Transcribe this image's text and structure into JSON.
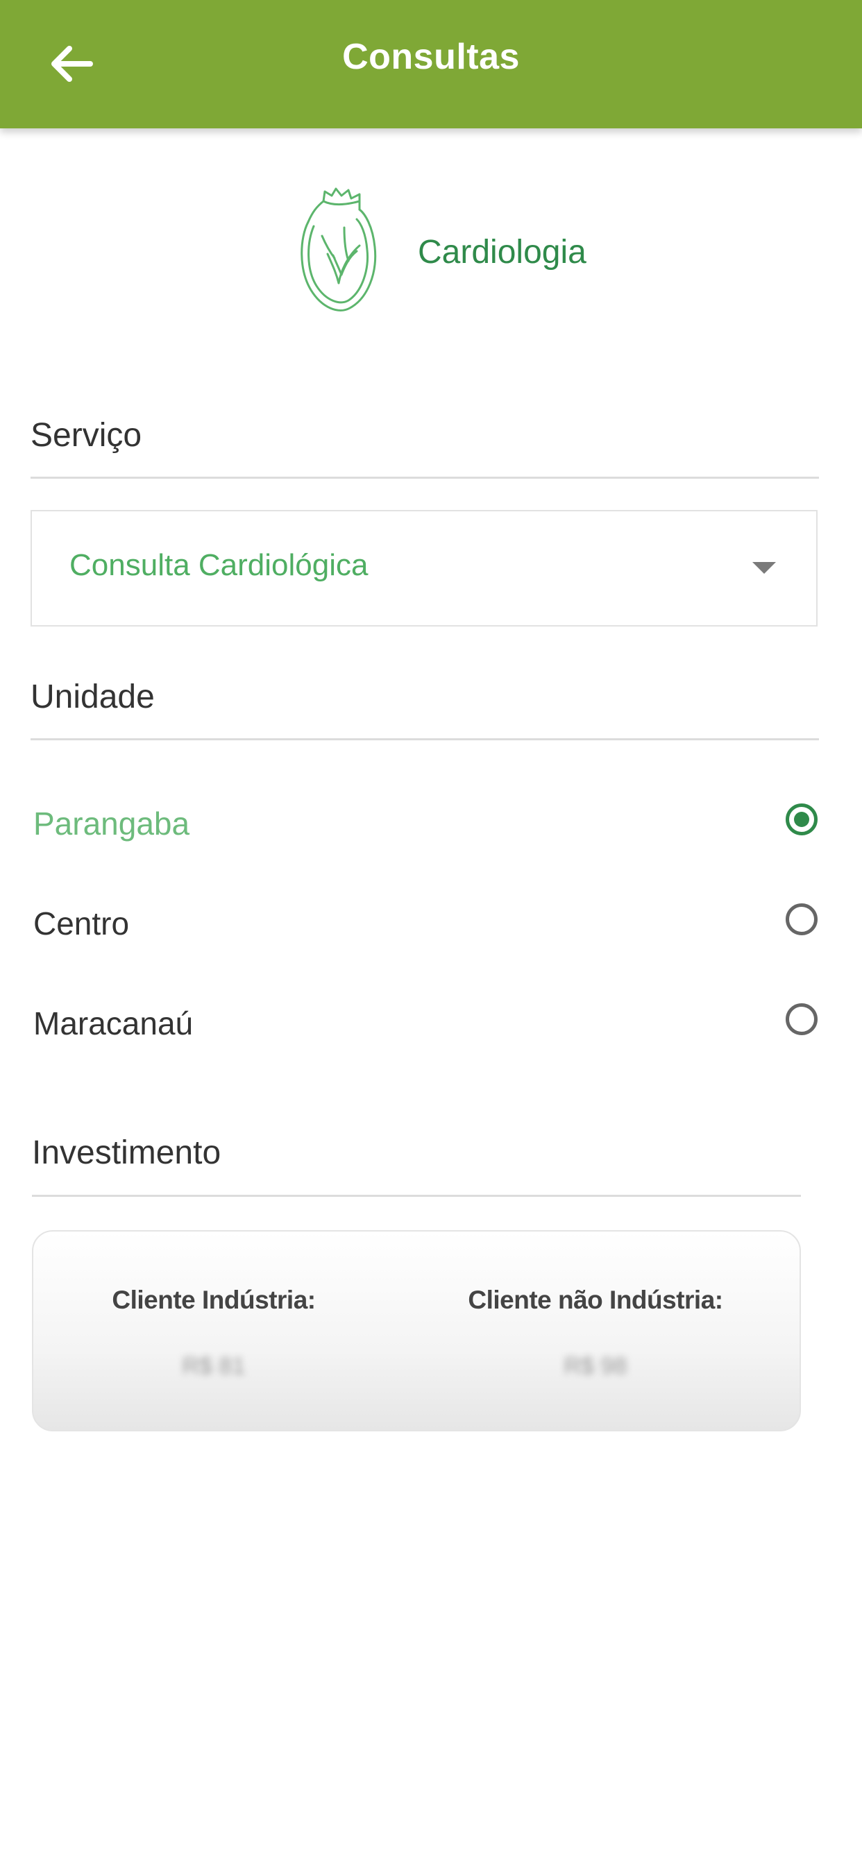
{
  "header": {
    "title": "Consultas",
    "back_icon": "arrow-left-icon",
    "color": "#7fa836"
  },
  "specialty": {
    "icon": "heart-icon",
    "name": "Cardiologia"
  },
  "service": {
    "label": "Serviço",
    "selected": "Consulta Cardiológica"
  },
  "unit": {
    "label": "Unidade",
    "options": [
      {
        "label": "Parangaba",
        "selected": true
      },
      {
        "label": "Centro",
        "selected": false
      },
      {
        "label": "Maracanaú",
        "selected": false
      }
    ]
  },
  "investment": {
    "label": "Investimento",
    "industry_title": "Cliente Indústria:",
    "industry_price": "R$ 81",
    "non_industry_title": "Cliente não Indústria:",
    "non_industry_price": "R$ 98"
  },
  "colors": {
    "accent_green": "#2f8a4a",
    "light_green": "#6dbb7c"
  }
}
